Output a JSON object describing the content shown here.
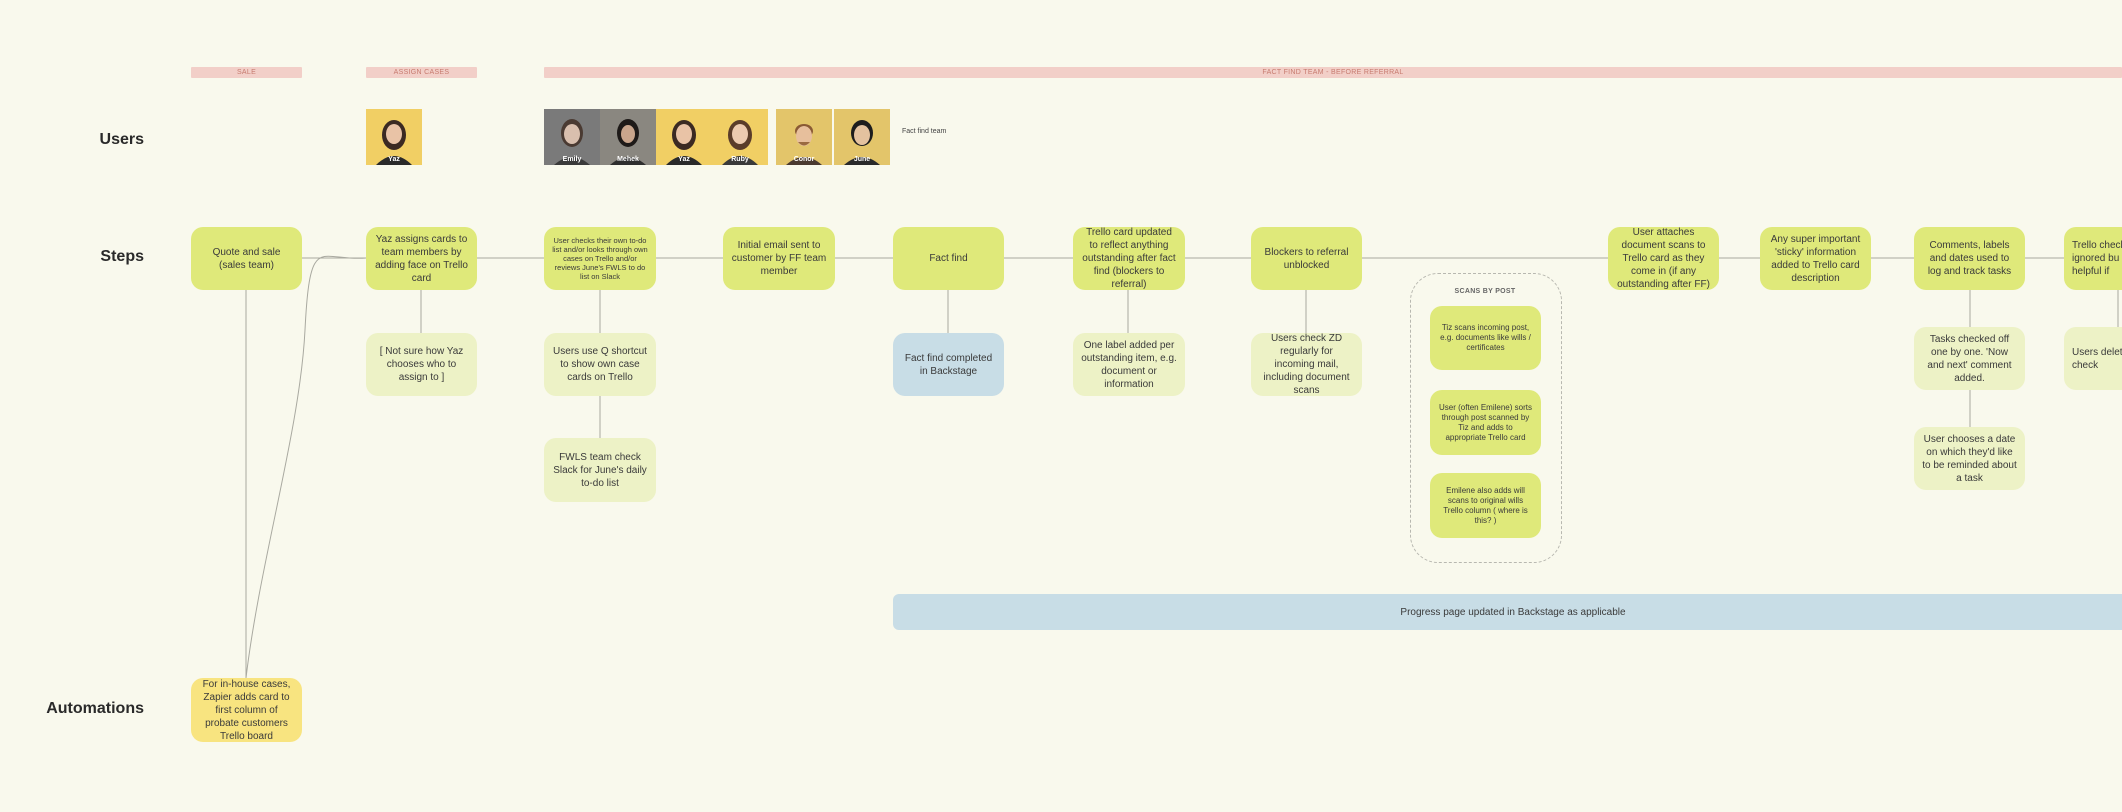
{
  "lanes": {
    "users": "Users",
    "steps": "Steps",
    "automations": "Automations"
  },
  "phases": {
    "sale": "SALE",
    "assign": "ASSIGN CASES",
    "factfind": "FACT FIND TEAM - BEFORE REFERRAL"
  },
  "users": {
    "yaz_single": "Yaz",
    "team": [
      "Emily",
      "Mehek",
      "Yaz",
      "Ruby",
      "Conor",
      "June"
    ],
    "team_label": "Fact find team"
  },
  "steps": {
    "quote": "Quote and sale (sales team)",
    "assign": "Yaz assigns cards to team members by adding face on Trello card",
    "checks": "User checks their own to-do list and/or looks through own cases on Trello and/or reviews June's FWLS to do list on Slack",
    "email": "Initial email sent to customer by FF team member",
    "factfind": "Fact find",
    "trello_updated": "Trello card updated to reflect anything outstanding after fact find (blockers to referral)",
    "blockers": "Blockers to referral unblocked",
    "attaches": "User attaches document scans to Trello card as they come in (if any outstanding after FF)",
    "sticky": "Any super important 'sticky' information added to Trello card description",
    "comments": "Comments, labels and dates used to log and track tasks",
    "checklist": "Trello checkl ignored bu helpful if"
  },
  "subs": {
    "not_sure": "[ Not sure how Yaz chooses who to assign to ]",
    "q_shortcut": "Users use Q shortcut to show own case cards on Trello",
    "fwls": "FWLS team check Slack for June's daily to-do list",
    "ff_completed": "Fact find completed in Backstage",
    "one_label": "One label added per outstanding item, e.g. document or information",
    "check_zd": "Users check ZD regularly for incoming mail, including document scans",
    "tasks_off": "Tasks checked off one by one. 'Now and next' comment added.",
    "date": "User chooses a date on which they'd like to be reminded about a task",
    "delete": "Users delete w check"
  },
  "scans": {
    "title": "SCANS BY POST",
    "items": [
      "Tiz scans incoming post, e.g. documents like wills / certificates",
      "User (often Emilene) sorts through post scanned by Tiz and adds to appropriate Trello card",
      "Emilene also adds will scans to original wills Trello column ( where is this? )"
    ]
  },
  "progress": "Progress page updated in Backstage as applicable",
  "automation": "For in-house cases, Zapier adds card to first column of probate customers Trello board",
  "colors": {
    "green": "#dfe97a",
    "pale": "#edf2c6",
    "blue": "#c8dde6",
    "yellow": "#f8e480",
    "phase": "#f2cfc8"
  }
}
